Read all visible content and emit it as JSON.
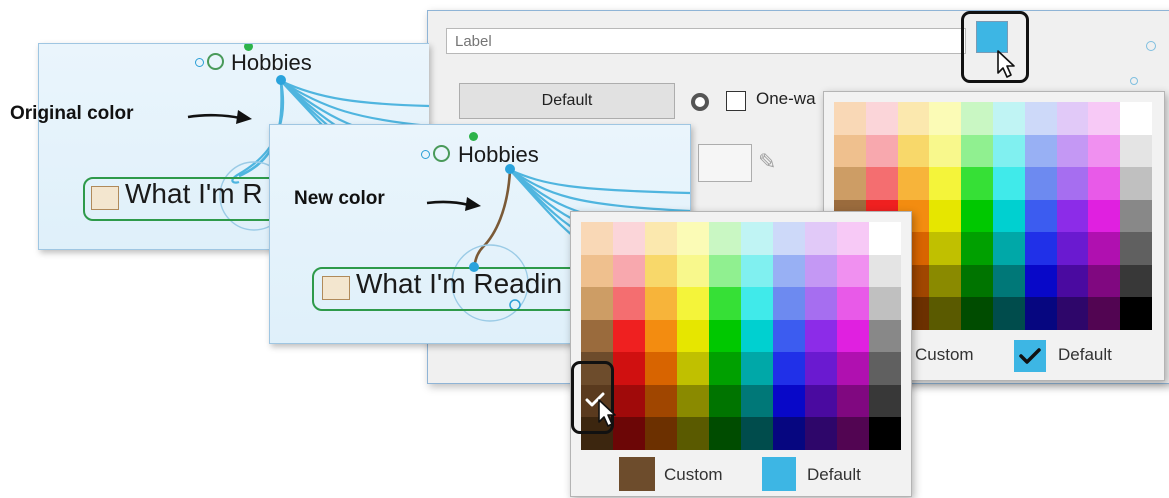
{
  "annotations": {
    "original_color": "Original color",
    "new_color": "New color"
  },
  "map_original": {
    "topic": "Hobbies",
    "subtopic": "What I'm R",
    "branch_color": "#4fb5df"
  },
  "map_new": {
    "topic": "Hobbies",
    "subtopic": "What I'm Readin",
    "branch_color": "#7b5a37"
  },
  "dialog": {
    "label_placeholder": "Label",
    "default_button": "Default",
    "one_way_label": "One-wa",
    "color_button_color": "#3db6e4"
  },
  "palette_colors": [
    [
      "#f9d8b6",
      "#fbd5d9",
      "#fbe8ae",
      "#fbfbb6",
      "#c9f7c3",
      "#c0f4f4",
      "#cdd9f9",
      "#e1c9f8",
      "#f7c9f6",
      "#ffffff"
    ],
    [
      "#efc08e",
      "#f8a8ae",
      "#f8d86a",
      "#f8f88c",
      "#90f090",
      "#80f0f0",
      "#98b0f4",
      "#c498f4",
      "#f090f0",
      "#e4e4e4"
    ],
    [
      "#cd9d65",
      "#f46e70",
      "#f7b43a",
      "#f4f43a",
      "#36e036",
      "#40eaea",
      "#6d8af0",
      "#a66ef0",
      "#e85ae8",
      "#c0c0c0"
    ],
    [
      "#9a6b3d",
      "#ef2020",
      "#f38c10",
      "#e6e600",
      "#00c800",
      "#00d0d0",
      "#3c5cf0",
      "#8c2ce8",
      "#e020e0",
      "#888888"
    ],
    [
      "#6d4c2c",
      "#d01010",
      "#d86400",
      "#c0c000",
      "#00a000",
      "#00a8a8",
      "#2030e8",
      "#6a1ad0",
      "#b010b0",
      "#606060"
    ],
    [
      "#5a3a1e",
      "#a00a0a",
      "#a04600",
      "#8a8a00",
      "#007400",
      "#007878",
      "#0808c8",
      "#4a0aa0",
      "#800880",
      "#383838"
    ],
    [
      "#3c260f",
      "#6c0606",
      "#6c3000",
      "#5a5a00",
      "#004c00",
      "#004c4c",
      "#060680",
      "#2e066a",
      "#520552",
      "#000000"
    ]
  ],
  "palette_back": {
    "custom_label": "Custom",
    "default_label": "Default",
    "custom_color": "#6d4c2c",
    "default_color": "#3db6e4",
    "default_checked": true
  },
  "palette_front": {
    "custom_label": "Custom",
    "default_label": "Default",
    "custom_color": "#6d4c2c",
    "default_color": "#3db6e4"
  }
}
